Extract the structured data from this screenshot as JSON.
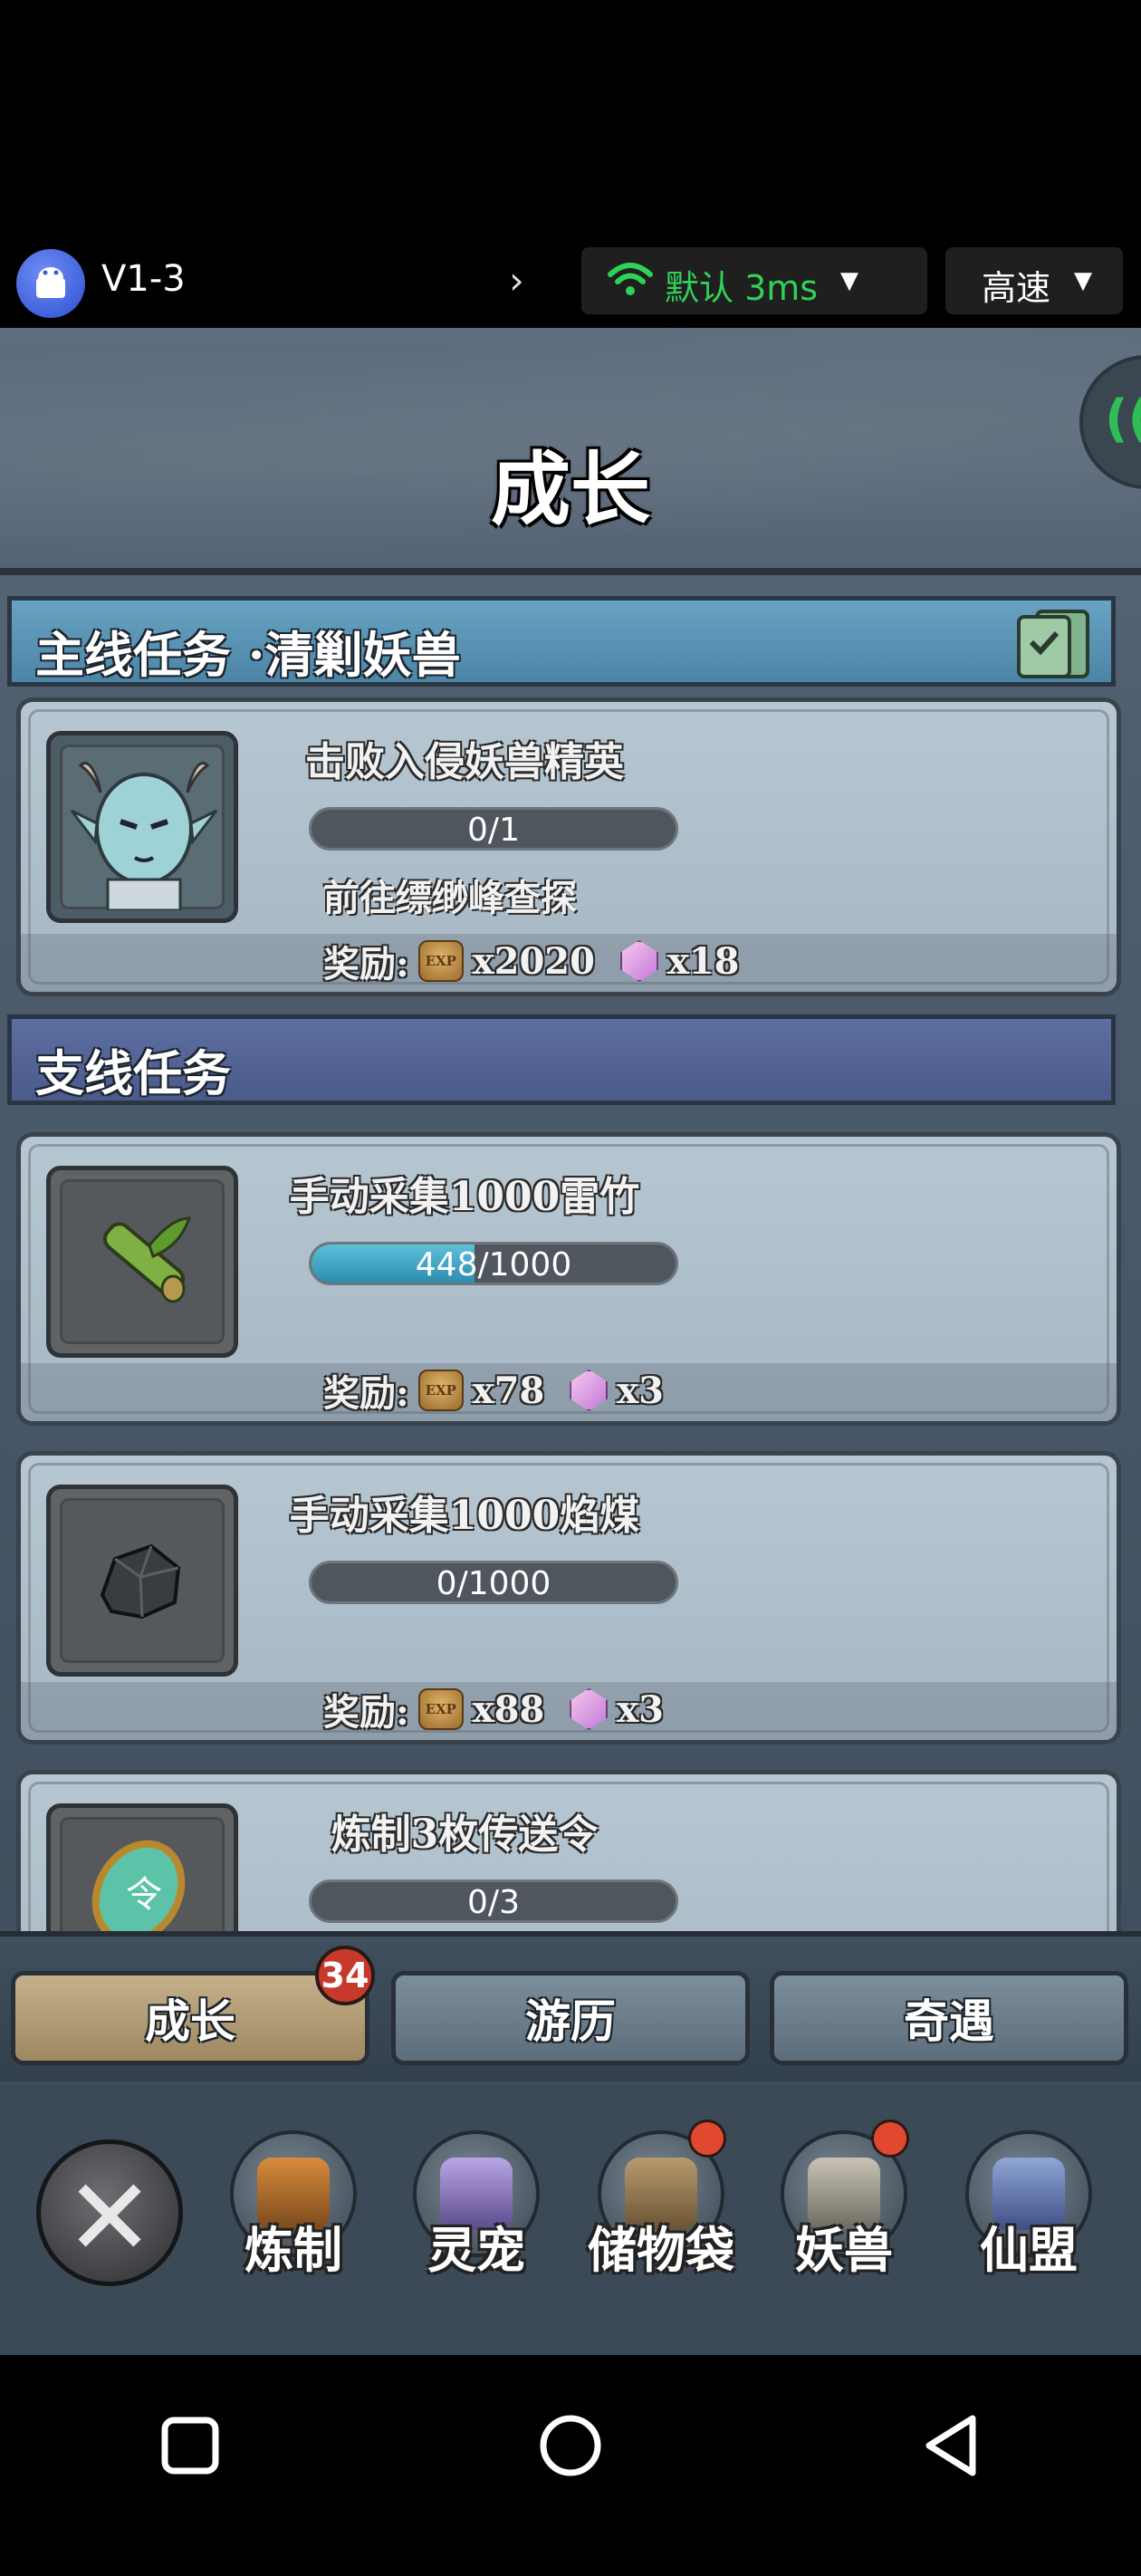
{
  "status_bar": {
    "app_title": "V1-3",
    "network_label": "默认 3ms",
    "speed_label": "高速",
    "colors": {
      "network_green": "#30d158"
    }
  },
  "game": {
    "page_title": "成长",
    "main_section": {
      "label": "主线任务 ·清剿妖兽"
    },
    "side_section": {
      "label": "支线任务"
    },
    "main_quest": {
      "title": "击败入侵妖兽精英",
      "progress_text": "0/1",
      "progress": 0.0,
      "description": "前往缥缈峰查探",
      "reward_label": "奖励:",
      "exp_icon": "exp-coin-icon",
      "exp_amount": "x2020",
      "gem_icon": "pink-gem-icon",
      "gem_amount": "x18"
    },
    "side_quests": [
      {
        "title": "手动采集1000雷竹",
        "progress_text": "448/1000",
        "progress": 0.448,
        "reward_label": "奖励:",
        "exp_amount": "x78",
        "gem_amount": "x3",
        "icon": "bamboo-icon"
      },
      {
        "title": "手动采集1000焰煤",
        "progress_text": "0/1000",
        "progress": 0.0,
        "reward_label": "奖励:",
        "exp_amount": "x88",
        "gem_amount": "x3",
        "icon": "coal-icon"
      },
      {
        "title": "炼制3枚传送令",
        "progress_text": "0/3",
        "progress": 0.0,
        "icon": "teleport-token-icon"
      }
    ],
    "tabs": [
      {
        "label": "成长",
        "active": true,
        "badge": "34"
      },
      {
        "label": "游历",
        "active": false
      },
      {
        "label": "奇遇",
        "active": false
      }
    ],
    "functions": [
      {
        "label": "炼制",
        "icon": "anvil-icon",
        "dot": false
      },
      {
        "label": "灵宠",
        "icon": "pet-icon",
        "dot": false
      },
      {
        "label": "储物袋",
        "icon": "bag-icon",
        "dot": true
      },
      {
        "label": "妖兽",
        "icon": "beast-icon",
        "dot": true
      },
      {
        "label": "仙盟",
        "icon": "pagoda-icon",
        "dot": false
      }
    ],
    "colors": {
      "progress_fill": "#2c8db0",
      "badge_red": "#c73a2b",
      "active_tab": "#c4b08a"
    }
  }
}
